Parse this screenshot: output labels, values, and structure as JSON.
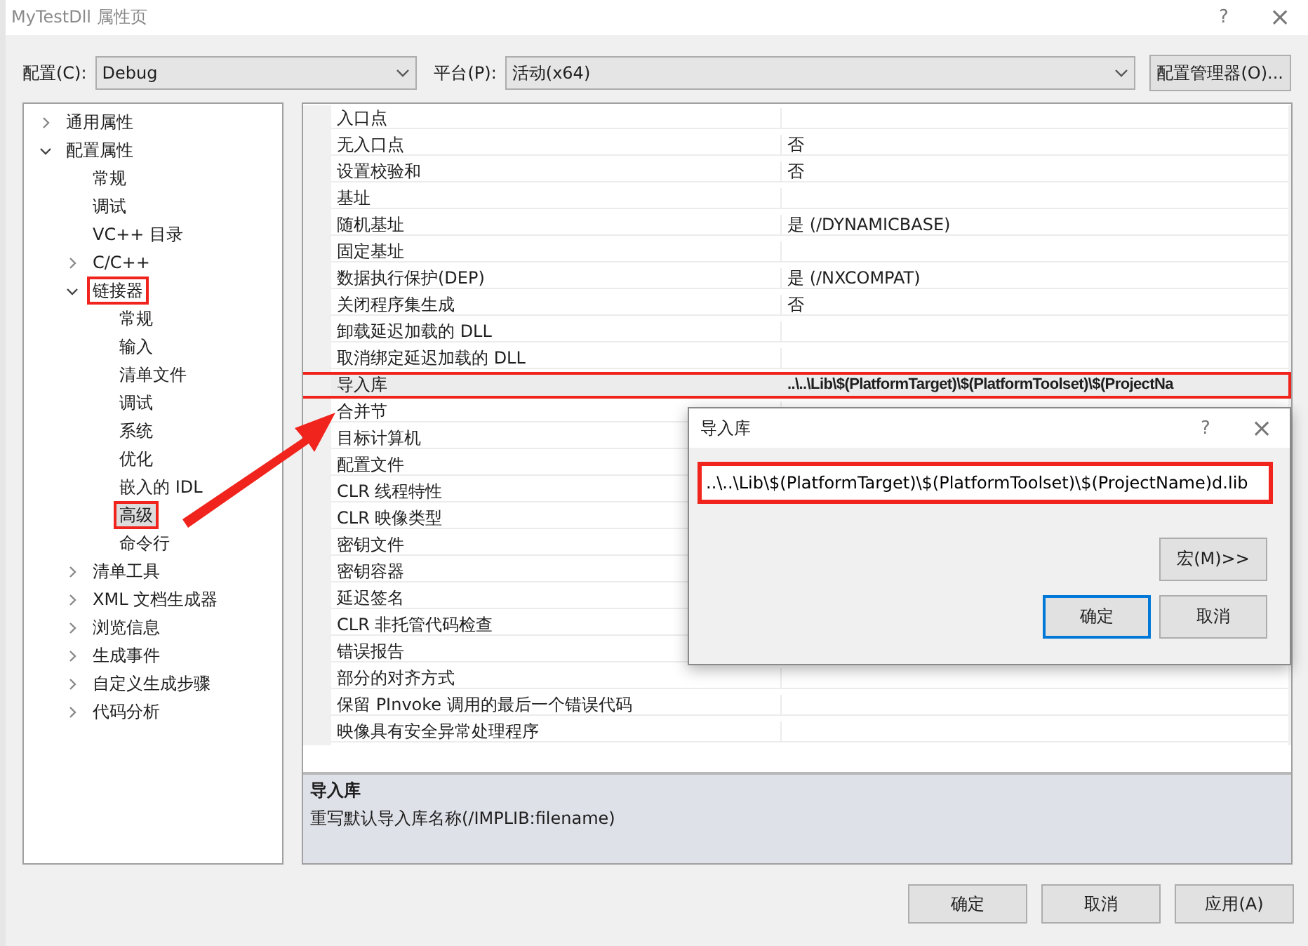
{
  "window": {
    "title": "MyTestDll 属性页",
    "help": "?",
    "close": "×"
  },
  "config_bar": {
    "config_label": "配置(C):",
    "config_value": "Debug",
    "platform_label": "平台(P):",
    "platform_value": "活动(x64)",
    "manager_button": "配置管理器(O)..."
  },
  "tree": [
    {
      "label": "通用属性",
      "expanded": false,
      "selected": false,
      "highlighted": false
    },
    {
      "label": "配置属性",
      "expanded": true,
      "selected": false,
      "highlighted": false,
      "children": [
        {
          "label": "常规",
          "selected": false,
          "highlighted": false
        },
        {
          "label": "调试",
          "selected": false,
          "highlighted": false
        },
        {
          "label": "VC++ 目录",
          "selected": false,
          "highlighted": false
        },
        {
          "label": "C/C++",
          "expanded": false,
          "selected": false,
          "highlighted": false
        },
        {
          "label": "链接器",
          "expanded": true,
          "selected": false,
          "highlighted": true,
          "children": [
            {
              "label": "常规",
              "selected": false,
              "highlighted": false
            },
            {
              "label": "输入",
              "selected": false,
              "highlighted": false
            },
            {
              "label": "清单文件",
              "selected": false,
              "highlighted": false
            },
            {
              "label": "调试",
              "selected": false,
              "highlighted": false
            },
            {
              "label": "系统",
              "selected": false,
              "highlighted": false
            },
            {
              "label": "优化",
              "selected": false,
              "highlighted": false
            },
            {
              "label": "嵌入的 IDL",
              "selected": false,
              "highlighted": false
            },
            {
              "label": "高级",
              "selected": true,
              "highlighted": true
            },
            {
              "label": "命令行",
              "selected": false,
              "highlighted": false
            }
          ]
        },
        {
          "label": "清单工具",
          "expanded": false,
          "selected": false,
          "highlighted": false
        },
        {
          "label": "XML 文档生成器",
          "expanded": false,
          "selected": false,
          "highlighted": false
        },
        {
          "label": "浏览信息",
          "expanded": false,
          "selected": false,
          "highlighted": false
        },
        {
          "label": "生成事件",
          "expanded": false,
          "selected": false,
          "highlighted": false
        },
        {
          "label": "自定义生成步骤",
          "expanded": false,
          "selected": false,
          "highlighted": false
        },
        {
          "label": "代码分析",
          "expanded": false,
          "selected": false,
          "highlighted": false
        }
      ]
    }
  ],
  "properties": [
    {
      "name": "入口点",
      "selected": false,
      "highlighted": false
    },
    {
      "name": "无入口点",
      "value": "否",
      "selected": false,
      "modified": false,
      "highlighted": false
    },
    {
      "name": "设置校验和",
      "value": "否",
      "selected": false,
      "modified": false,
      "highlighted": false
    },
    {
      "name": "基址",
      "selected": false,
      "highlighted": false
    },
    {
      "name": "随机基址",
      "value": "是 (/DYNAMICBASE)",
      "selected": false,
      "modified": false,
      "highlighted": false
    },
    {
      "name": "固定基址",
      "selected": false,
      "highlighted": false
    },
    {
      "name": "数据执行保护(DEP)",
      "value": "是 (/NXCOMPAT)",
      "selected": false,
      "modified": false,
      "highlighted": false
    },
    {
      "name": "关闭程序集生成",
      "value": "否",
      "selected": false,
      "modified": false,
      "highlighted": false
    },
    {
      "name": "卸载延迟加载的 DLL",
      "selected": false,
      "highlighted": false
    },
    {
      "name": "取消绑定延迟加载的 DLL",
      "selected": false,
      "highlighted": false
    },
    {
      "name": "导入库",
      "value": "..\\..\\Lib\\$(PlatformTarget)\\$(PlatformToolset)\\$(ProjectNa",
      "selected": true,
      "modified": true,
      "highlighted": true
    },
    {
      "name": "合并节",
      "selected": false,
      "highlighted": false
    },
    {
      "name": "目标计算机",
      "selected": false,
      "highlighted": false
    },
    {
      "name": "配置文件",
      "selected": false,
      "highlighted": false
    },
    {
      "name": "CLR 线程特性",
      "selected": false,
      "highlighted": false
    },
    {
      "name": "CLR 映像类型",
      "selected": false,
      "highlighted": false
    },
    {
      "name": "密钥文件",
      "selected": false,
      "highlighted": false
    },
    {
      "name": "密钥容器",
      "selected": false,
      "highlighted": false
    },
    {
      "name": "延迟签名",
      "selected": false,
      "highlighted": false
    },
    {
      "name": "CLR 非托管代码检查",
      "selected": false,
      "highlighted": false
    },
    {
      "name": "错误报告",
      "selected": false,
      "highlighted": false
    },
    {
      "name": "部分的对齐方式",
      "selected": false,
      "highlighted": false
    },
    {
      "name": "保留 PInvoke 调用的最后一个错误代码",
      "selected": false,
      "highlighted": false
    },
    {
      "name": "映像具有安全异常处理程序",
      "selected": false,
      "highlighted": false
    }
  ],
  "description": {
    "title": "导入库",
    "text": "重写默认导入库名称(/IMPLIB:filename)"
  },
  "dialog": {
    "title": "导入库",
    "help": "?",
    "close": "×",
    "value": "..\\..\\Lib\\$(PlatformTarget)\\$(PlatformToolset)\\$(ProjectName)d.lib",
    "highlighted": true,
    "macro_button": "宏(M)>>",
    "buttons": [
      {
        "label": "确定",
        "default": true
      },
      {
        "label": "取消",
        "default": false
      }
    ]
  },
  "buttons": [
    "确定",
    "取消",
    "应用(A)"
  ]
}
